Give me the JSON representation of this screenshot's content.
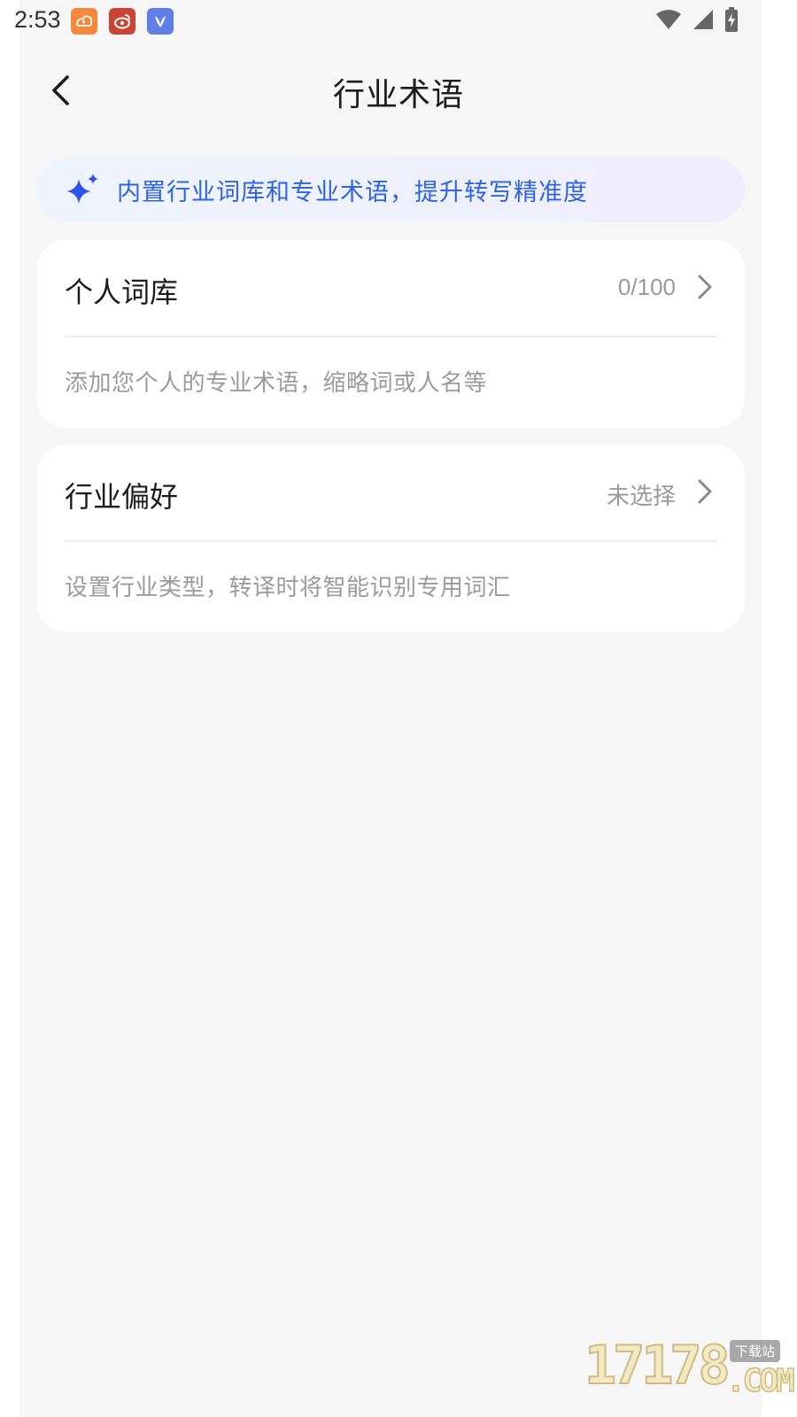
{
  "status_bar": {
    "time": "2:53",
    "notification_icons": [
      "app-notification-icon",
      "weibo-icon",
      "bird-app-icon"
    ],
    "system_icons": [
      "wifi-icon",
      "cellular-signal-icon",
      "battery-charging-icon"
    ]
  },
  "header": {
    "title": "行业术语",
    "back_icon": "chevron-left-icon"
  },
  "banner": {
    "icon": "sparkle-icon",
    "text": "内置行业词库和专业术语，提升转写精准度",
    "color": "#2d63e6"
  },
  "cards": [
    {
      "title": "个人词库",
      "value": "0/100",
      "description": "添加您个人的专业术语，缩略词或人名等"
    },
    {
      "title": "行业偏好",
      "value": "未选择",
      "description": "设置行业类型，转译时将智能识别专用词汇"
    }
  ],
  "watermark": {
    "digits": "17178",
    "tag": "下载站",
    "suffix": ".COM"
  }
}
